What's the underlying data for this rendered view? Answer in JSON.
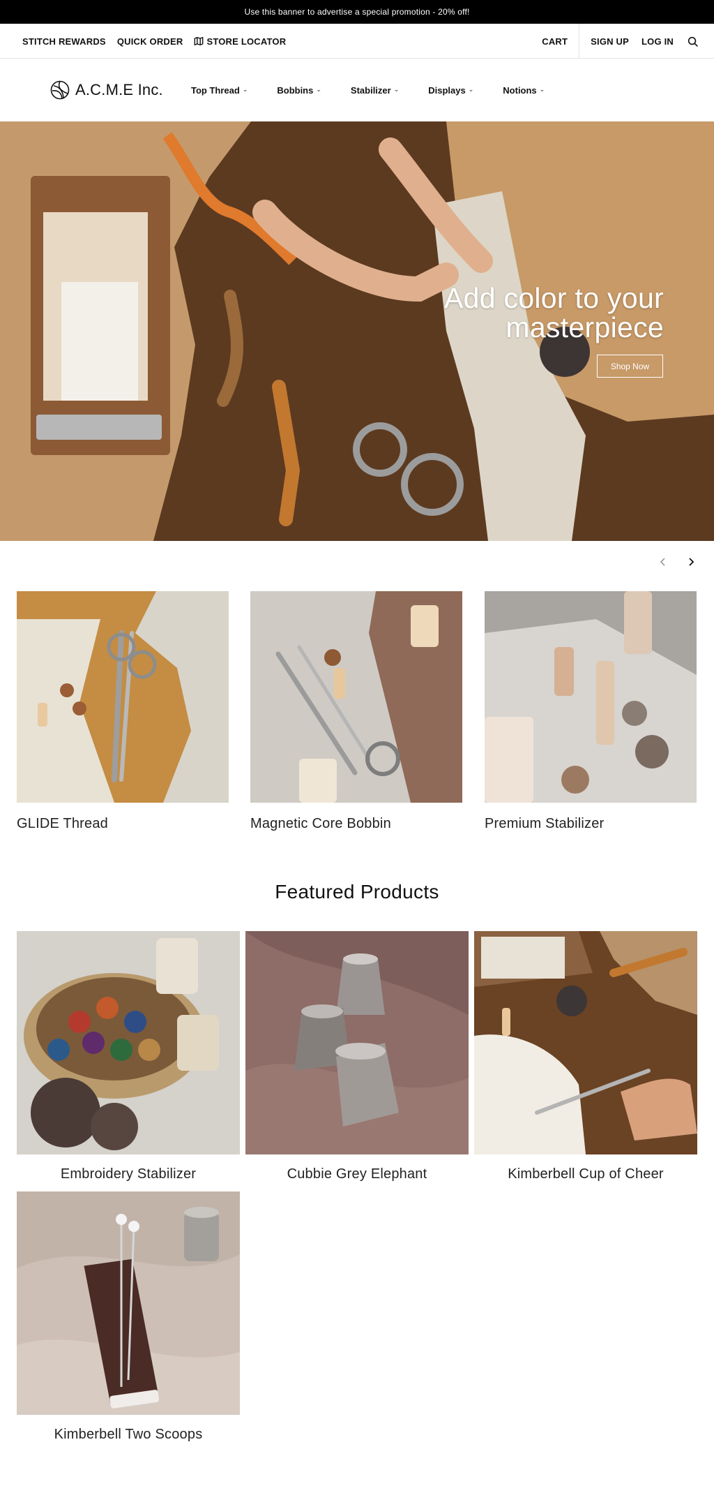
{
  "promo": {
    "text": "Use this banner to advertise a special promotion - 20% off!"
  },
  "utility_nav": {
    "left": [
      {
        "label": "STITCH REWARDS"
      },
      {
        "label": "QUICK ORDER"
      },
      {
        "label": "STORE LOCATOR",
        "icon": "map-icon"
      }
    ],
    "cart": "CART",
    "sign_up": "SIGN UP",
    "log_in": "LOG IN",
    "search_icon": "search-icon"
  },
  "brand": {
    "name": "A.C.M.E Inc.",
    "logo_icon": "logo-icon"
  },
  "menu": [
    {
      "label": "Top Thread"
    },
    {
      "label": "Bobbins"
    },
    {
      "label": "Stabilizer"
    },
    {
      "label": "Displays"
    },
    {
      "label": "Notions"
    }
  ],
  "hero": {
    "title_line1": "Add color to your",
    "title_line2": "masterpiece",
    "button": "Shop Now"
  },
  "carousel": {
    "prev_icon": "chevron-left-icon",
    "next_icon": "chevron-right-icon",
    "items": [
      {
        "label": "GLIDE Thread"
      },
      {
        "label": "Magnetic Core Bobbin"
      },
      {
        "label": "Premium Stabilizer"
      }
    ]
  },
  "featured": {
    "title": "Featured Products",
    "items": [
      {
        "label": "Embroidery Stabilizer"
      },
      {
        "label": "Cubbie Grey Elephant"
      },
      {
        "label": "Kimberbell Cup of Cheer"
      },
      {
        "label": "Kimberbell Two Scoops"
      }
    ]
  },
  "colors": {
    "promo_bg": "#000000",
    "text": "#111111",
    "accent_wood": "#8b5b35"
  }
}
